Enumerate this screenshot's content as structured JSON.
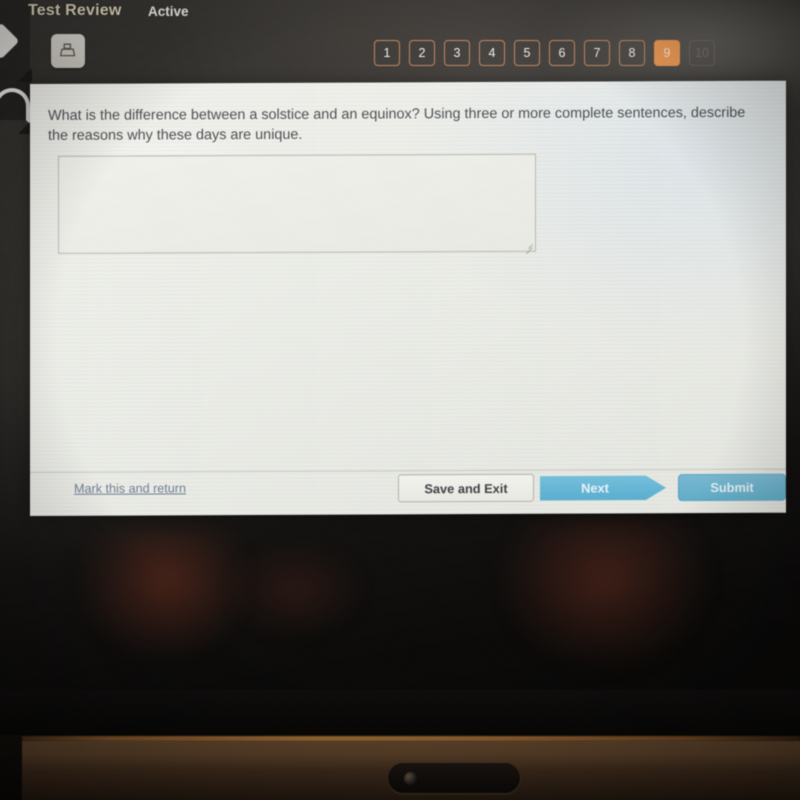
{
  "header": {
    "title": "Test Review",
    "status": "Active",
    "print_icon": "printer-icon"
  },
  "question_nav": {
    "buttons": [
      "1",
      "2",
      "3",
      "4",
      "5",
      "6",
      "7",
      "8",
      "9"
    ],
    "current": "9",
    "partial_next": "10",
    "active_color": "#ec9a56",
    "border_color": "#c28a62"
  },
  "question": {
    "text": "What is the difference between a solstice and an equinox? Using three or more complete sentences, describe the reasons why these days are unique."
  },
  "answer": {
    "value": "",
    "placeholder": ""
  },
  "actions": {
    "mark_link": "Mark this and return",
    "save_exit": "Save and Exit",
    "next": "Next",
    "submit": "Submit",
    "next_color": "#57aecf",
    "submit_color": "#62aec9",
    "link_color": "#6f7f93"
  }
}
